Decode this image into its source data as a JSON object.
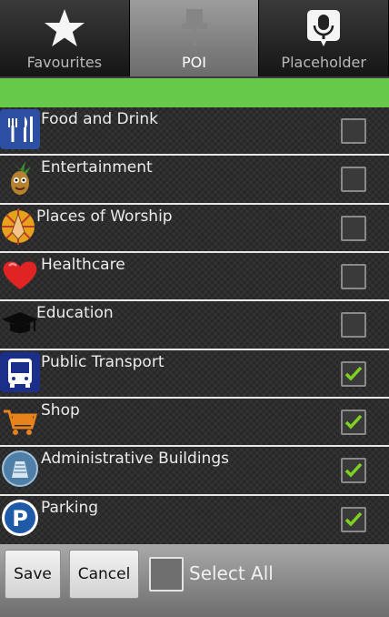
{
  "tabs": [
    {
      "label": "Favourites",
      "icon": "star-icon",
      "active": false
    },
    {
      "label": "POI",
      "icon": "pushpin-icon",
      "active": true
    },
    {
      "label": "Placeholder",
      "icon": "microphone-icon",
      "active": false
    }
  ],
  "categories": [
    {
      "label": "Food and Drink",
      "icon": "fork-knife-icon",
      "checked": false
    },
    {
      "label": "Entertainment",
      "icon": "pineapple-icon",
      "checked": false
    },
    {
      "label": "Places of Worship",
      "icon": "praying-hands-icon",
      "checked": false
    },
    {
      "label": "Healthcare",
      "icon": "heart-icon",
      "checked": false
    },
    {
      "label": "Education",
      "icon": "graduation-cap-icon",
      "checked": false
    },
    {
      "label": "Public Transport",
      "icon": "bus-icon",
      "checked": true
    },
    {
      "label": "Shop",
      "icon": "shopping-cart-icon",
      "checked": true
    },
    {
      "label": "Administrative Buildings",
      "icon": "building-icon",
      "checked": true
    },
    {
      "label": "Parking",
      "icon": "parking-icon",
      "checked": true
    }
  ],
  "bottom": {
    "save_label": "Save",
    "cancel_label": "Cancel",
    "select_all_label": "Select All",
    "select_all_checked": false
  },
  "colors": {
    "accent_green": "#66c94a",
    "check_green": "#7ed321"
  }
}
